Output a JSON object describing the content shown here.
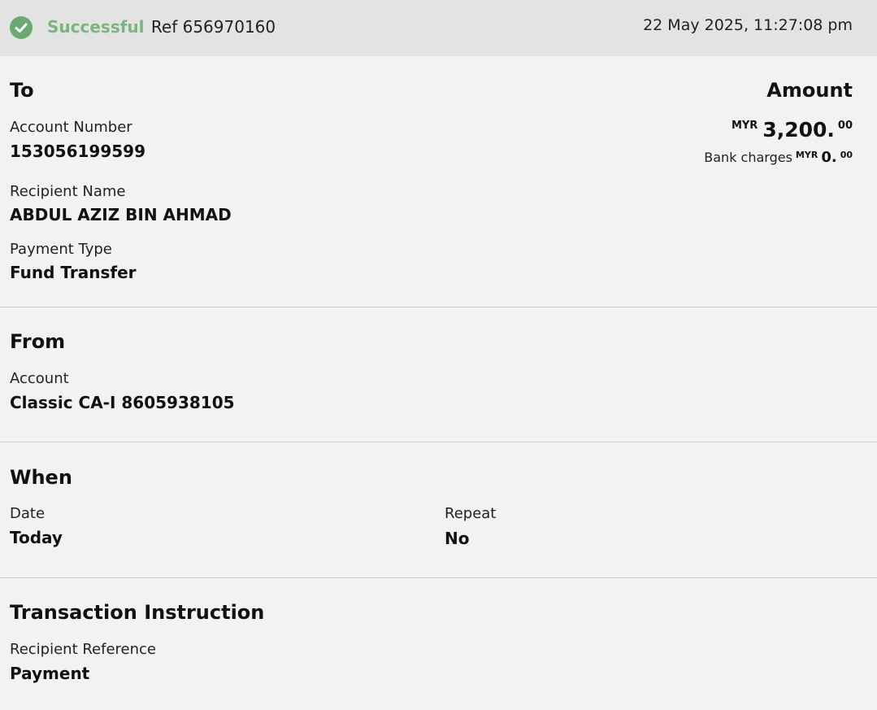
{
  "status": {
    "label": "Successful",
    "ref": "Ref 656970160",
    "datetime": "22 May 2025, 11:27:08 pm",
    "icon": "check-circle-icon",
    "color": "#7bb57e"
  },
  "to": {
    "heading": "To",
    "account_number_label": "Account Number",
    "account_number": "153056199599",
    "recipient_name_label": "Recipient Name",
    "recipient_name": "ABDUL AZIZ BIN AHMAD",
    "payment_type_label": "Payment Type",
    "payment_type": "Fund Transfer"
  },
  "amount": {
    "heading": "Amount",
    "currency": "MYR",
    "whole": "3,200.",
    "cents": "00",
    "bank_charges_label": "Bank charges",
    "charges_currency": "MYR",
    "charges_whole": "0.",
    "charges_cents": "00"
  },
  "from": {
    "heading": "From",
    "account_label": "Account",
    "account": "Classic CA-I 8605938105"
  },
  "when": {
    "heading": "When",
    "date_label": "Date",
    "date": "Today",
    "repeat_label": "Repeat",
    "repeat": "No"
  },
  "instruction": {
    "heading": "Transaction Instruction",
    "recipient_reference_label": "Recipient Reference",
    "recipient_reference": "Payment"
  }
}
